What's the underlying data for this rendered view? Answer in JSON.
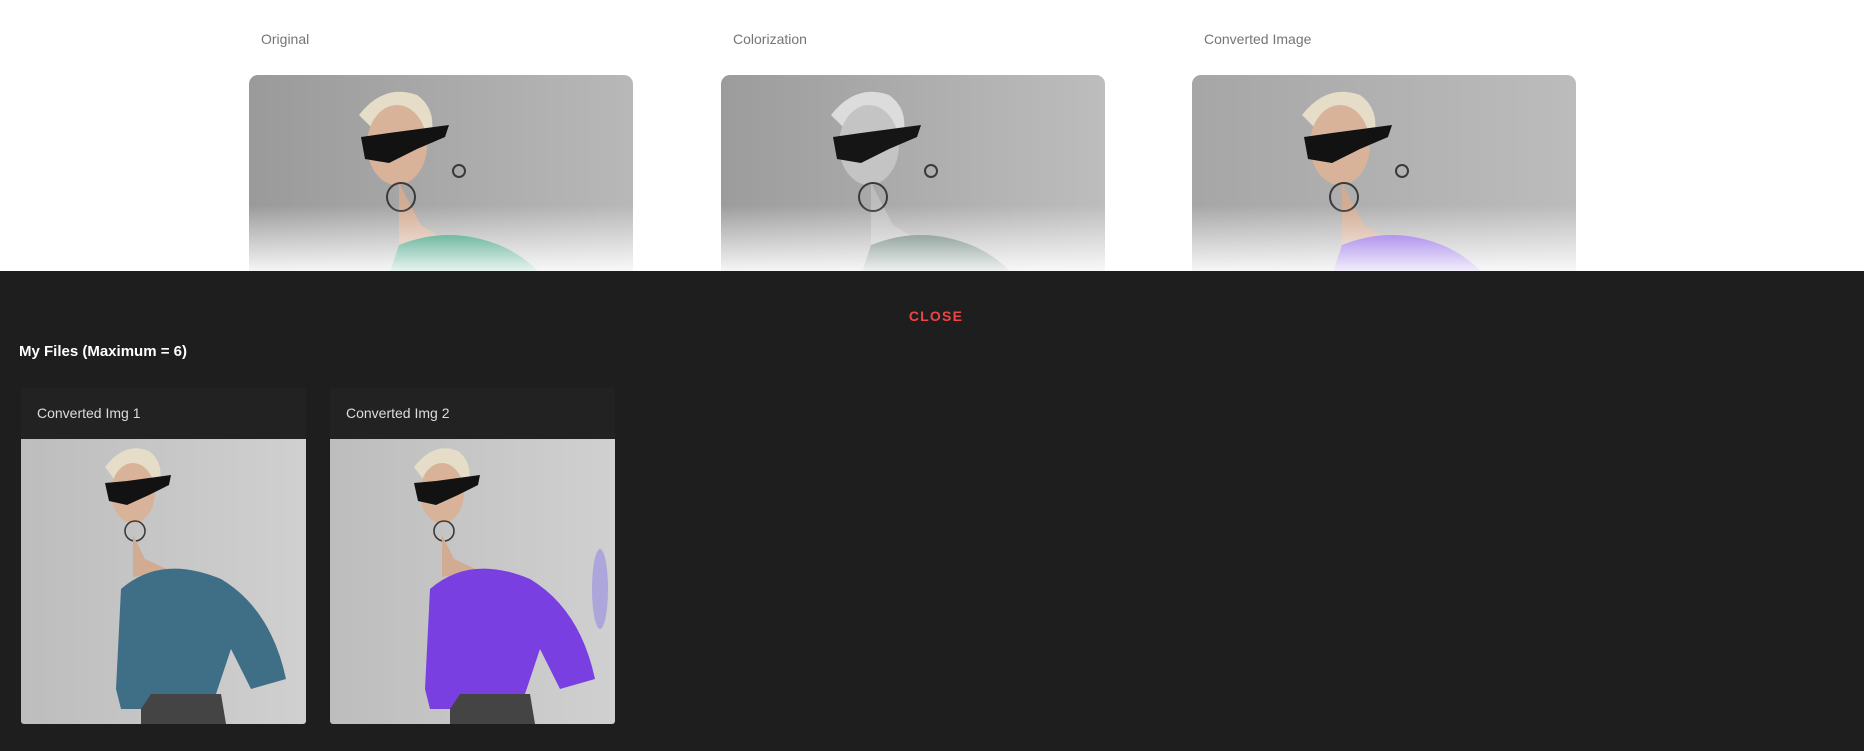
{
  "columns": {
    "original_label": "Original",
    "colorization_label": "Colorization",
    "converted_label": "Converted Image"
  },
  "drawer": {
    "close_label": "CLOSE",
    "title": "My Files (Maximum = 6)",
    "files": [
      {
        "title": "Converted Img 1",
        "shirt_color": "#3f6f86"
      },
      {
        "title": "Converted Img 2",
        "shirt_color": "#7a3fe0"
      }
    ]
  },
  "colors": {
    "accent_close": "#ef4444",
    "drawer_bg": "#1e1e1e",
    "original_shirt": "#0f8a62",
    "colorization_shirt": "#4f6b62",
    "converted_shirt": "#7b4ce0"
  }
}
